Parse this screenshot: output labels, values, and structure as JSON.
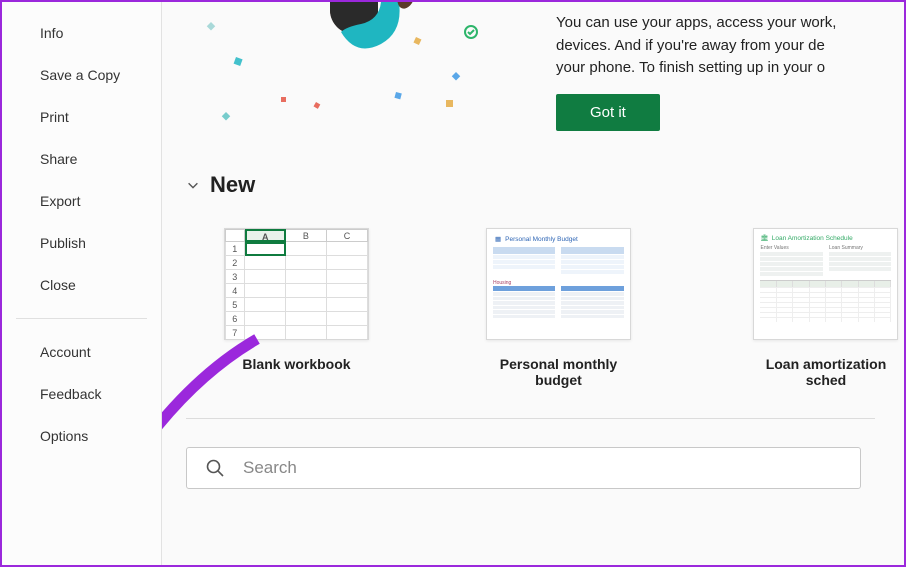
{
  "sidebar": {
    "items": [
      "Info",
      "Save a Copy",
      "Print",
      "Share",
      "Export",
      "Publish",
      "Close"
    ],
    "bottom_items": [
      "Account",
      "Feedback",
      "Options"
    ]
  },
  "banner": {
    "line1": "You can use your apps, access your work,",
    "line2": "devices. And if you're away from your de",
    "line3": "your phone. To finish setting up in your o",
    "button_label": "Got it"
  },
  "new_section": {
    "title": "New",
    "templates": [
      {
        "label": "Blank workbook"
      },
      {
        "label": "Personal monthly budget",
        "thumb_title": "Personal Monthly Budget"
      },
      {
        "label": "Loan amortization sched",
        "thumb_title": "Loan Amortization Schedule",
        "thumb_col1": "Enter Values",
        "thumb_col2": "Loan Summary"
      }
    ]
  },
  "search": {
    "placeholder": "Search"
  }
}
